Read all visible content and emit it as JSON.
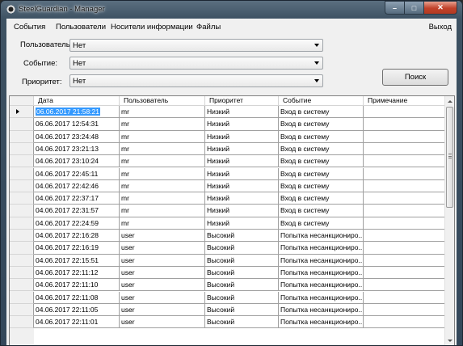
{
  "window": {
    "title": "SteelGuardian - Manager",
    "controls": {
      "minimize": "–",
      "maximize": "□",
      "close": "✕"
    }
  },
  "menu": {
    "items": [
      "События",
      "Пользователи",
      "Носители информации",
      "Файлы"
    ],
    "exit": "Выход"
  },
  "filters": {
    "user": {
      "label": "Пользователь:",
      "value": "Нет"
    },
    "event": {
      "label": "Событие:",
      "value": "Нет"
    },
    "priority": {
      "label": "Приоритет:",
      "value": "Нет"
    },
    "search_button": "Поиск"
  },
  "table": {
    "columns": [
      "Дата",
      "Пользователь",
      "Приоритет",
      "Событие",
      "Примечание"
    ],
    "rows": [
      [
        "06.06.2017 21:58:21",
        "mr",
        "Низкий",
        "Вход в систему",
        ""
      ],
      [
        "06.06.2017 12:54:31",
        "mr",
        "Низкий",
        "Вход в систему",
        ""
      ],
      [
        "04.06.2017 23:24:48",
        "mr",
        "Низкий",
        "Вход в систему",
        ""
      ],
      [
        "04.06.2017 23:21:13",
        "mr",
        "Низкий",
        "Вход в систему",
        ""
      ],
      [
        "04.06.2017 23:10:24",
        "mr",
        "Низкий",
        "Вход в систему",
        ""
      ],
      [
        "04.06.2017 22:45:11",
        "mr",
        "Низкий",
        "Вход в систему",
        ""
      ],
      [
        "04.06.2017 22:42:46",
        "mr",
        "Низкий",
        "Вход в систему",
        ""
      ],
      [
        "04.06.2017 22:37:17",
        "mr",
        "Низкий",
        "Вход в систему",
        ""
      ],
      [
        "04.06.2017 22:31:57",
        "mr",
        "Низкий",
        "Вход в систему",
        ""
      ],
      [
        "04.06.2017 22:24:59",
        "mr",
        "Низкий",
        "Вход в систему",
        ""
      ],
      [
        "04.06.2017 22:16:28",
        "user",
        "Высокий",
        "Попытка несанкциониро...",
        ""
      ],
      [
        "04.06.2017 22:16:19",
        "user",
        "Высокий",
        "Попытка несанкциониро...",
        ""
      ],
      [
        "04.06.2017 22:15:51",
        "user",
        "Высокий",
        "Попытка несанкциониро...",
        ""
      ],
      [
        "04.06.2017 22:11:12",
        "user",
        "Высокий",
        "Попытка несанкциониро...",
        ""
      ],
      [
        "04.06.2017 22:11:10",
        "user",
        "Высокий",
        "Попытка несанкциониро...",
        ""
      ],
      [
        "04.06.2017 22:11:08",
        "user",
        "Высокий",
        "Попытка несанкциониро...",
        ""
      ],
      [
        "04.06.2017 22:11:05",
        "user",
        "Высокий",
        "Попытка несанкциониро...",
        ""
      ],
      [
        "04.06.2017 22:11:01",
        "user",
        "Высокий",
        "Попытка несанкциониро...",
        ""
      ]
    ],
    "selected_row": 0
  },
  "colors": {
    "selection": "#3399ff",
    "close_button": "#c0412a"
  }
}
